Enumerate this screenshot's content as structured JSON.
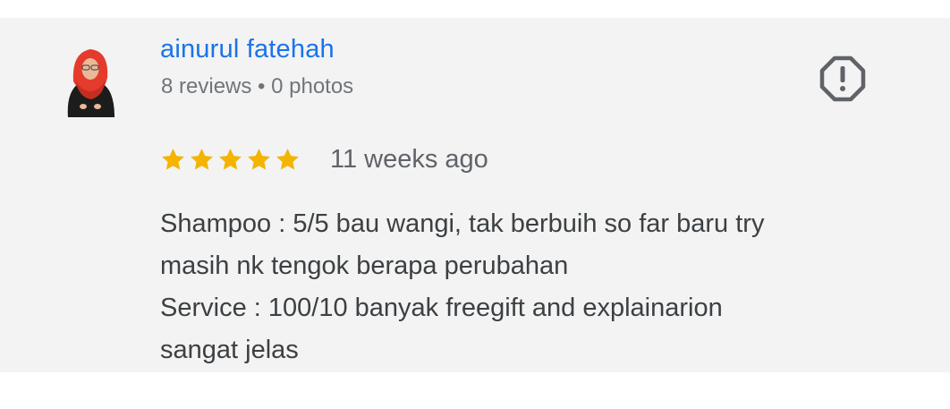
{
  "review": {
    "author": {
      "name": "ainurul fatehah",
      "meta": "8 reviews • 0 photos",
      "avatar": "avatar-photo"
    },
    "report_icon": "report-flag-icon",
    "rating": {
      "stars": 5,
      "max": 5,
      "icon": "star-icon",
      "color": "#f4b400"
    },
    "date": "11 weeks ago",
    "text_lines": [
      "Shampoo : 5/5 bau wangi, tak berbuih so far baru try",
      "masih nk tengok berapa perubahan",
      "Service : 100/10 banyak freegift and explainarion",
      "sangat jelas"
    ],
    "colors": {
      "author_link": "#1a73e8",
      "meta_text": "#70757a",
      "body_text": "#3c4043",
      "card_background": "#f3f3f3",
      "icon": "#5f6368"
    }
  }
}
